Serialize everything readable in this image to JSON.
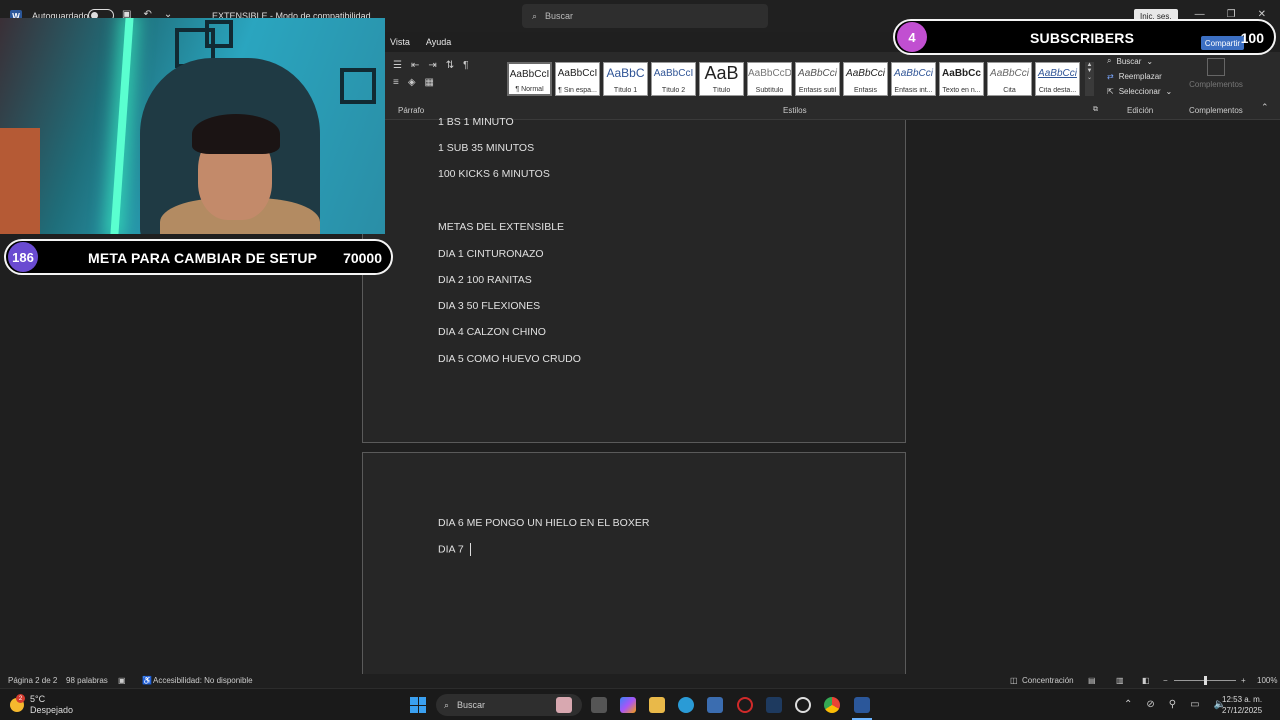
{
  "titlebar": {
    "app_letter": "W",
    "autosave_label": "Autoguardado",
    "doc_title": "EXTENSIBLE - Modo de compatibilidad",
    "search_placeholder": "Buscar",
    "login_label": "Inic. ses."
  },
  "ribbon": {
    "tabs": [
      "Vista",
      "Ayuda"
    ],
    "paragraph_label": "Párrafo",
    "styles_label": "Estilos",
    "edit_label": "Edición",
    "complements_label": "Complementos",
    "complements_button": "Complementos",
    "styles": [
      {
        "preview": "AaBbCcI",
        "label": "¶ Normal"
      },
      {
        "preview": "AaBbCcI",
        "label": "¶ Sin espa..."
      },
      {
        "preview": "AaBbC",
        "label": "Título 1"
      },
      {
        "preview": "AaBbCcI",
        "label": "Título 2"
      },
      {
        "preview": "AaB",
        "label": "Título"
      },
      {
        "preview": "AaBbCcD",
        "label": "Subtítulo"
      },
      {
        "preview": "AaBbCci",
        "label": "Énfasis sutil"
      },
      {
        "preview": "AaBbCci",
        "label": "Énfasis"
      },
      {
        "preview": "AaBbCci",
        "label": "Énfasis int..."
      },
      {
        "preview": "AaBbCc",
        "label": "Texto en n..."
      },
      {
        "preview": "AaBbCci",
        "label": "Cita"
      },
      {
        "preview": "AaBbCci",
        "label": "Cita desta..."
      }
    ],
    "edit_items": [
      "Buscar",
      "Reemplazar",
      "Seleccionar"
    ]
  },
  "document": {
    "page1_lines": [
      "1 BS 1 MINUTO",
      "1 SUB 35 MINUTOS",
      "100 KICKS 6 MINUTOS",
      "METAS DEL EXTENSIBLE",
      "DIA 1 CINTURONAZO",
      "DIA 2 100 RANITAS",
      "DIA 3 50 FLEXIONES",
      "DIA 4 CALZON CHINO",
      "DIA 5 COMO HUEVO CRUDO"
    ],
    "page2_lines": [
      "DIA 6 ME PONGO UN HIELO EN EL BOXER",
      "DIA 7"
    ]
  },
  "statusbar": {
    "page": "Página 2 de 2",
    "words": "98 palabras",
    "accessibility": "Accesibilidad: No disponible",
    "focus": "Concentración",
    "zoom": "100%"
  },
  "taskbar": {
    "weather_badge": "2",
    "temp": "5°C",
    "condition": "Despejado",
    "search": "Buscar",
    "time": "12:53 a. m.",
    "date": "27/12/2025"
  },
  "overlay": {
    "subscribers": {
      "count": "4",
      "title": "SUBSCRIBERS",
      "goal": "100",
      "share": "Compartir"
    },
    "meta": {
      "count": "186",
      "title": "META PARA CAMBIAR DE SETUP",
      "goal": "70000"
    }
  },
  "colors": {
    "sub_badge": "#c14fd1",
    "meta_badge": "#6a4bd1",
    "word_blue": "#2b579a"
  }
}
